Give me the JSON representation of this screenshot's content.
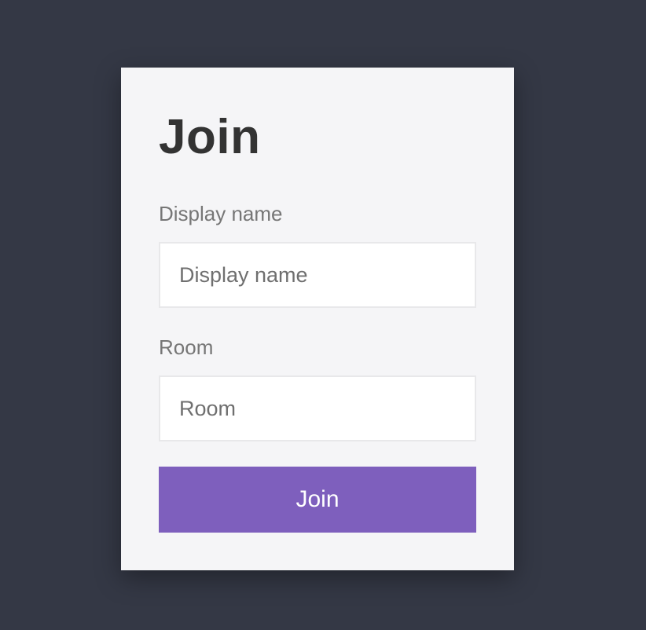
{
  "form": {
    "title": "Join",
    "display_name": {
      "label": "Display name",
      "placeholder": "Display name",
      "value": ""
    },
    "room": {
      "label": "Room",
      "placeholder": "Room",
      "value": ""
    },
    "submit_label": "Join"
  },
  "colors": {
    "background": "#343845",
    "card": "#f5f5f7",
    "button": "#7e5fbd",
    "title": "#333333",
    "label": "#767676"
  }
}
